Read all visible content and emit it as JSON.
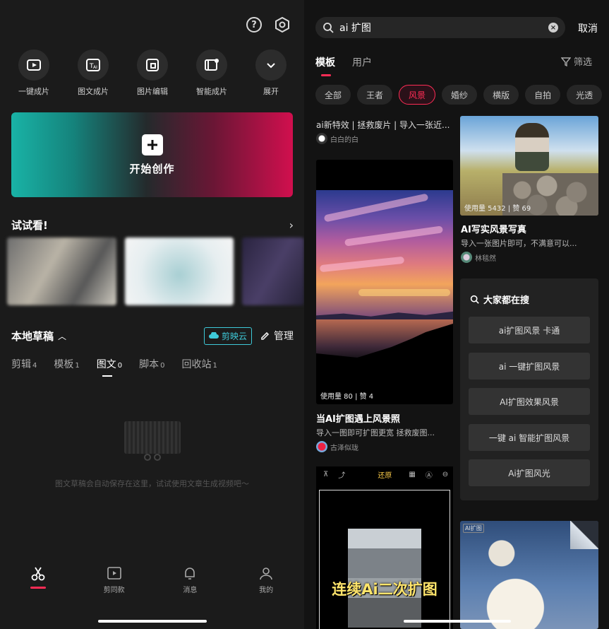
{
  "left": {
    "quick_actions": [
      {
        "label": "一键成片",
        "icon": "one-click-video-icon"
      },
      {
        "label": "图文成片",
        "icon": "text-to-video-icon"
      },
      {
        "label": "图片编辑",
        "icon": "image-edit-icon"
      },
      {
        "label": "智能成片",
        "icon": "smart-video-icon"
      },
      {
        "label": "展开",
        "icon": "chevron-down-icon"
      }
    ],
    "create_label": "开始创作",
    "try_title": "试试看!",
    "drafts_title": "本地草稿",
    "cloud_label": "剪映云",
    "manage_label": "管理",
    "draft_tabs": [
      {
        "label": "剪辑",
        "count": "4"
      },
      {
        "label": "模板",
        "count": "1"
      },
      {
        "label": "图文",
        "count": "0"
      },
      {
        "label": "脚本",
        "count": "0"
      },
      {
        "label": "回收站",
        "count": "1"
      }
    ],
    "empty_tip": "图文草稿会自动保存在这里，试试使用文章生成视频吧～",
    "tabbar": [
      {
        "label": "",
        "icon": "scissors-icon"
      },
      {
        "label": "剪同款",
        "icon": "template-icon"
      },
      {
        "label": "消息",
        "icon": "bell-icon"
      },
      {
        "label": "我的",
        "icon": "profile-icon"
      }
    ]
  },
  "right": {
    "search_value": "ai 扩图",
    "cancel_label": "取消",
    "tabs": [
      "模板",
      "用户"
    ],
    "filter_label": "筛选",
    "chips": [
      "全部",
      "王者",
      "风景",
      "婚纱",
      "横版",
      "自拍",
      "光透"
    ],
    "card1": {
      "title": "ai新特效 | 拯救废片 | 导入一张近...",
      "author": "白白的白"
    },
    "card2": {
      "stats": "使用量 80 | 赞 4",
      "title": "当AI扩图遇上风景照",
      "desc": "导入一图即可扩图更宽 拯救废图...",
      "author": "古泽似珑"
    },
    "card3": {
      "stats": "使用量 5432 | 赞 69",
      "title": "AI写实风景写真",
      "desc": "导入一张图片即可，不满意可以...",
      "author": "林毯然"
    },
    "panel_title": "大家都在搜",
    "panel_items": [
      "ai扩图风景 卡通",
      "ai 一键扩图风景",
      "AI扩图效果风景",
      "一键 ai 智能扩图风景",
      "Ai扩图风光"
    ],
    "card4": {
      "toolbar_tag": "还原",
      "caption": "连续Ai二次扩图"
    },
    "card5": {
      "tag": "AI扩图"
    }
  },
  "colors": {
    "accent": "#fe2c55",
    "cloud": "#3ec9d8",
    "caption": "#ffe56b"
  }
}
